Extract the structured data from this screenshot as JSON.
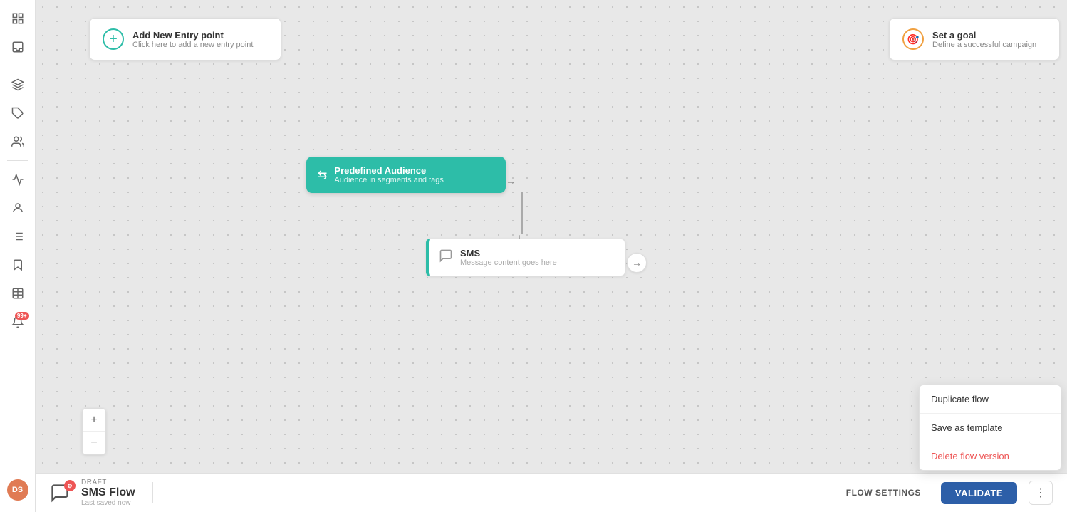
{
  "sidebar": {
    "items": [
      {
        "id": "grid-icon",
        "label": "Grid"
      },
      {
        "id": "inbox-icon",
        "label": "Inbox"
      },
      {
        "id": "layers-icon",
        "label": "Layers"
      },
      {
        "id": "tag-icon",
        "label": "Tag"
      },
      {
        "id": "users-icon",
        "label": "Users"
      },
      {
        "id": "chart-icon",
        "label": "Chart"
      },
      {
        "id": "people-icon",
        "label": "People"
      },
      {
        "id": "list-icon",
        "label": "List"
      },
      {
        "id": "bookmark-icon",
        "label": "Bookmark"
      },
      {
        "id": "table-icon",
        "label": "Table"
      }
    ],
    "avatar": "DS",
    "notification_count": "99+"
  },
  "canvas": {
    "add_entry": {
      "title": "Add New Entry point",
      "subtitle": "Click here to add a new entry point"
    },
    "set_goal": {
      "title": "Set a goal",
      "subtitle": "Define a successful campaign"
    },
    "audience_node": {
      "title": "Predefined Audience",
      "subtitle": "Audience in segments and tags"
    },
    "sms_node": {
      "title": "SMS",
      "subtitle": "Message content goes here"
    }
  },
  "zoom": {
    "level": "100%"
  },
  "bottom_bar": {
    "draft_label": "DRAFT",
    "flow_name": "SMS Flow",
    "saved_label": "Last saved now",
    "flow_settings_label": "FLOW SETTINGS",
    "validate_label": "VALIDATE"
  },
  "dropdown": {
    "items": [
      {
        "id": "duplicate-flow",
        "label": "Duplicate flow",
        "danger": false
      },
      {
        "id": "save-as-template",
        "label": "Save as template",
        "danger": false
      },
      {
        "id": "delete-flow-version",
        "label": "Delete flow version",
        "danger": true
      }
    ]
  }
}
